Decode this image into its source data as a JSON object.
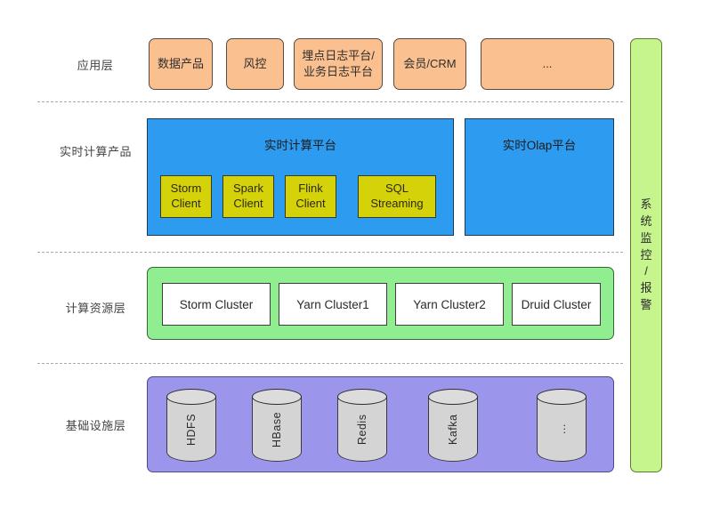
{
  "diagram": {
    "rows": [
      {
        "label": "应用层"
      },
      {
        "label": "实时计算产品"
      },
      {
        "label": "计算资源层"
      },
      {
        "label": "基础设施层"
      }
    ],
    "application_layer": {
      "boxes": [
        {
          "line1": "数据产品",
          "line2": ""
        },
        {
          "line1": "风控",
          "line2": ""
        },
        {
          "line1": "埋点日志平台/",
          "line2": "业务日志平台"
        },
        {
          "line1": "会员/CRM",
          "line2": ""
        },
        {
          "line1": "...",
          "line2": ""
        }
      ]
    },
    "realtime_layer": {
      "platform_title": "实时计算平台",
      "olap_title": "实时Olap平台",
      "clients": [
        {
          "line1": "Storm",
          "line2": "Client"
        },
        {
          "line1": "Spark",
          "line2": "Client"
        },
        {
          "line1": "Flink",
          "line2": "Client"
        },
        {
          "line1": "SQL",
          "line2": "Streaming"
        }
      ]
    },
    "resource_layer": {
      "clusters": [
        {
          "label": "Storm Cluster"
        },
        {
          "label": "Yarn Cluster1"
        },
        {
          "label": "Yarn Cluster2"
        },
        {
          "label": "Druid Cluster"
        }
      ]
    },
    "infrastructure_layer": {
      "stores": [
        {
          "label": "HDFS"
        },
        {
          "label": "HBase"
        },
        {
          "label": "Redis"
        },
        {
          "label": "Kafka"
        },
        {
          "label": "..."
        }
      ]
    },
    "monitoring": {
      "chars": [
        "系",
        "统",
        "监",
        "控",
        "/",
        "报",
        "警"
      ]
    },
    "colors": {
      "application": "#FAC08F",
      "realtime": "#2D9CF0",
      "client": "#D6D20A",
      "resource": "#90EE90",
      "infrastructure": "#9B96EC",
      "monitoring": "#C6F58E",
      "cylinder": "#D4D4D4"
    }
  }
}
